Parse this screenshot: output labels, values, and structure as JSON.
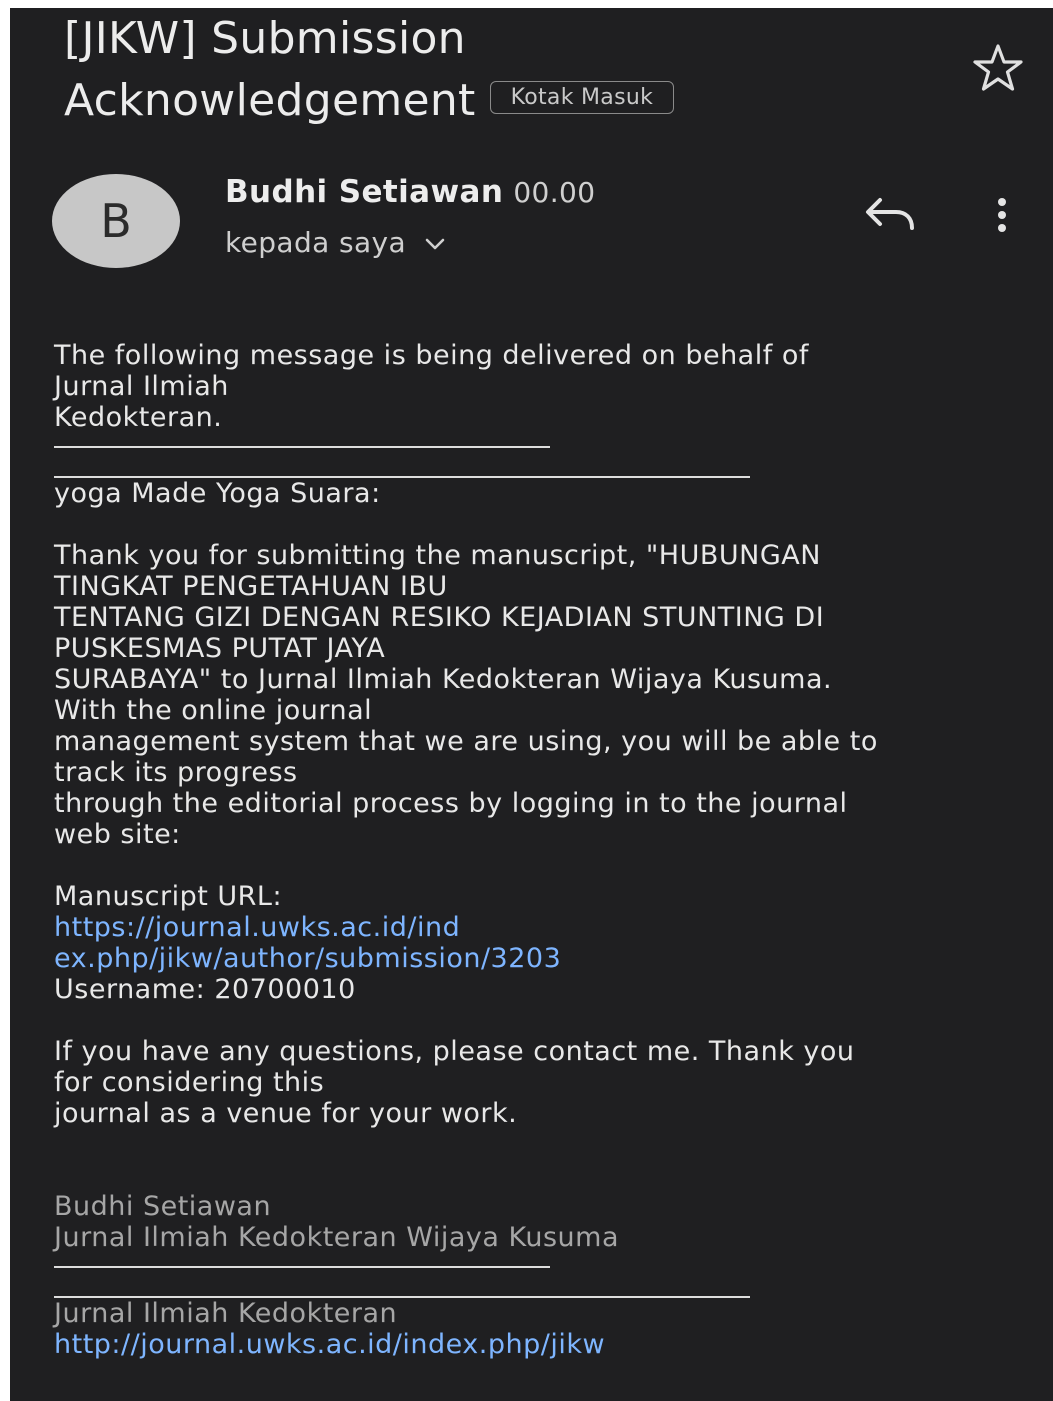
{
  "email": {
    "subject_line1": "[JIKW] Submission",
    "subject_line2": "Acknowledgement",
    "label": "Kotak Masuk",
    "sender_initial": "B",
    "sender_name": "Budhi Setiawan",
    "time": "00.00",
    "recipient": "kepada saya",
    "icons": {
      "star": "star-outline-icon",
      "reply": "reply-icon",
      "more": "more-vert-icon",
      "expand": "chevron-down-icon"
    }
  },
  "body": {
    "intro": "The following message is being delivered on behalf of\nJurnal Ilmiah\nKedokteran.",
    "salutation": "yoga Made Yoga Suara:",
    "paragraph1": "Thank you for submitting the manuscript, \"HUBUNGAN\nTINGKAT PENGETAHUAN IBU\nTENTANG GIZI DENGAN RESIKO KEJADIAN STUNTING DI\nPUSKESMAS PUTAT JAYA\nSURABAYA\" to Jurnal Ilmiah Kedokteran Wijaya Kusuma.\nWith the online journal\nmanagement system that we are using, you will be able to\ntrack its progress\nthrough the editorial process by logging in to the journal\nweb site:",
    "manuscript_url_label": "Manuscript URL:",
    "manuscript_url": "https://journal.uwks.ac.id/ind\nex.php/jikw/author/submission/3203",
    "username": "Username: 20700010",
    "closing": "If you have any questions, please contact me. Thank you\nfor considering this\njournal as a venue for your work.",
    "signature_name": "Budhi Setiawan",
    "signature_org": "Jurnal Ilmiah Kedokteran Wijaya Kusuma",
    "footer_journal": "Jurnal Ilmiah Kedokteran",
    "footer_url": "http://journal.uwks.ac.id/index.php/jikw"
  },
  "colors": {
    "background": "#1f1f21",
    "text": "#e8e8e8",
    "link": "#7eb5ff",
    "muted": "#a6a6a6",
    "avatar": "#c7c7c7"
  }
}
